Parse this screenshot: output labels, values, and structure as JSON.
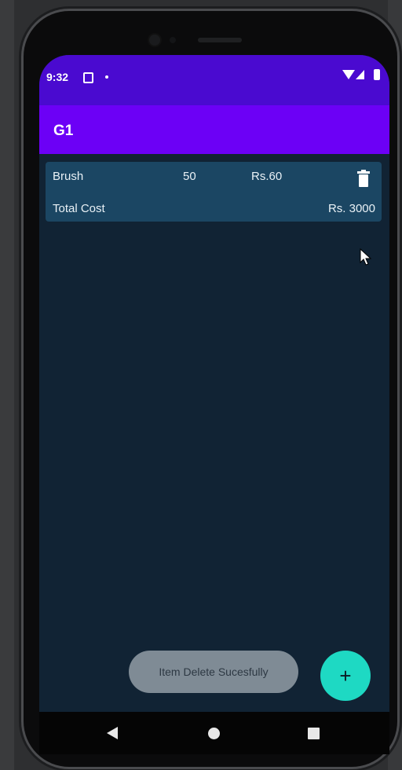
{
  "status_bar": {
    "time": "9:32"
  },
  "app_bar": {
    "title": "G1"
  },
  "item": {
    "name": "Brush",
    "quantity": "50",
    "price": "Rs.60"
  },
  "total": {
    "label": "Total Cost",
    "value": "Rs. 3000"
  },
  "toast": {
    "message": "Item Delete Sucesfully"
  },
  "fab": {
    "label": "+"
  },
  "icons": {
    "status": [
      "notification-icon",
      "dot-icon",
      "wifi-icon",
      "signal-icon",
      "battery-icon"
    ],
    "card": [
      "trash-icon"
    ],
    "navigation": [
      "back-icon",
      "home-icon",
      "recents-icon"
    ],
    "overlay": [
      "mouse-pointer-icon"
    ]
  },
  "colors": {
    "status_bar": "#4a0ad0",
    "app_bar": "#6c00f6",
    "background": "#112334",
    "card": "#1b4663",
    "fab": "#1ed9c3",
    "toast": "#7f8b95"
  }
}
